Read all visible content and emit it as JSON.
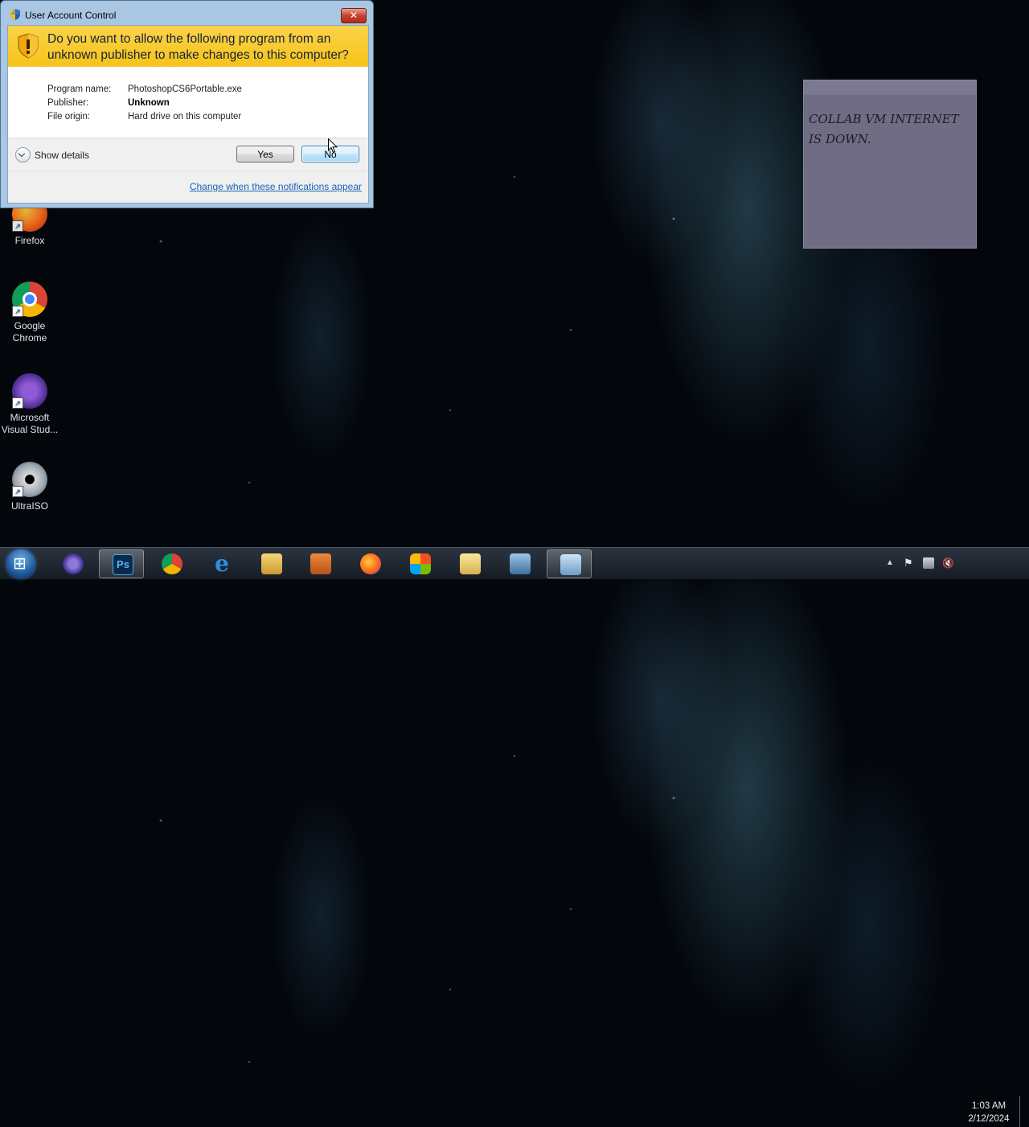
{
  "uac": {
    "window_title": "User Account Control",
    "close_label": "✕",
    "question": "Do you want to allow the following program from an unknown publisher to make changes to this computer?",
    "program_name_label": "Program name:",
    "program_name": "PhotoshopCS6Portable.exe",
    "publisher_label": "Publisher:",
    "publisher": "Unknown",
    "file_origin_label": "File origin:",
    "file_origin": "Hard drive on this computer",
    "show_details": "Show details",
    "yes_label": "Yes",
    "no_label": "No",
    "change_link": "Change when these notifications appear"
  },
  "desktop_icons": [
    {
      "label": "Firefox",
      "icon": "firefox-icon"
    },
    {
      "label": "Google Chrome",
      "icon": "chrome-icon"
    },
    {
      "label": "Microsoft Visual Stud...",
      "icon": "visual-studio-icon"
    },
    {
      "label": "UltraISO",
      "icon": "ultraiso-icon"
    }
  ],
  "sticky_note": {
    "text": "COLLAB VM INTERNET IS DOWN."
  },
  "taskbar": {
    "time": "1:03 AM",
    "date": "2/12/2024",
    "items": [
      "media-player-icon",
      "photoshop-icon",
      "chrome-icon",
      "internet-explorer-icon",
      "file-explorer-icon",
      "media-icon",
      "firefox-icon",
      "windows-flag-icon",
      "folder-icon",
      "migration-icon",
      "control-panel-icon"
    ]
  },
  "colors": {
    "uac_banner": "#f6c319",
    "link": "#1a64b4",
    "sticky_bg": "#6f6c84"
  }
}
